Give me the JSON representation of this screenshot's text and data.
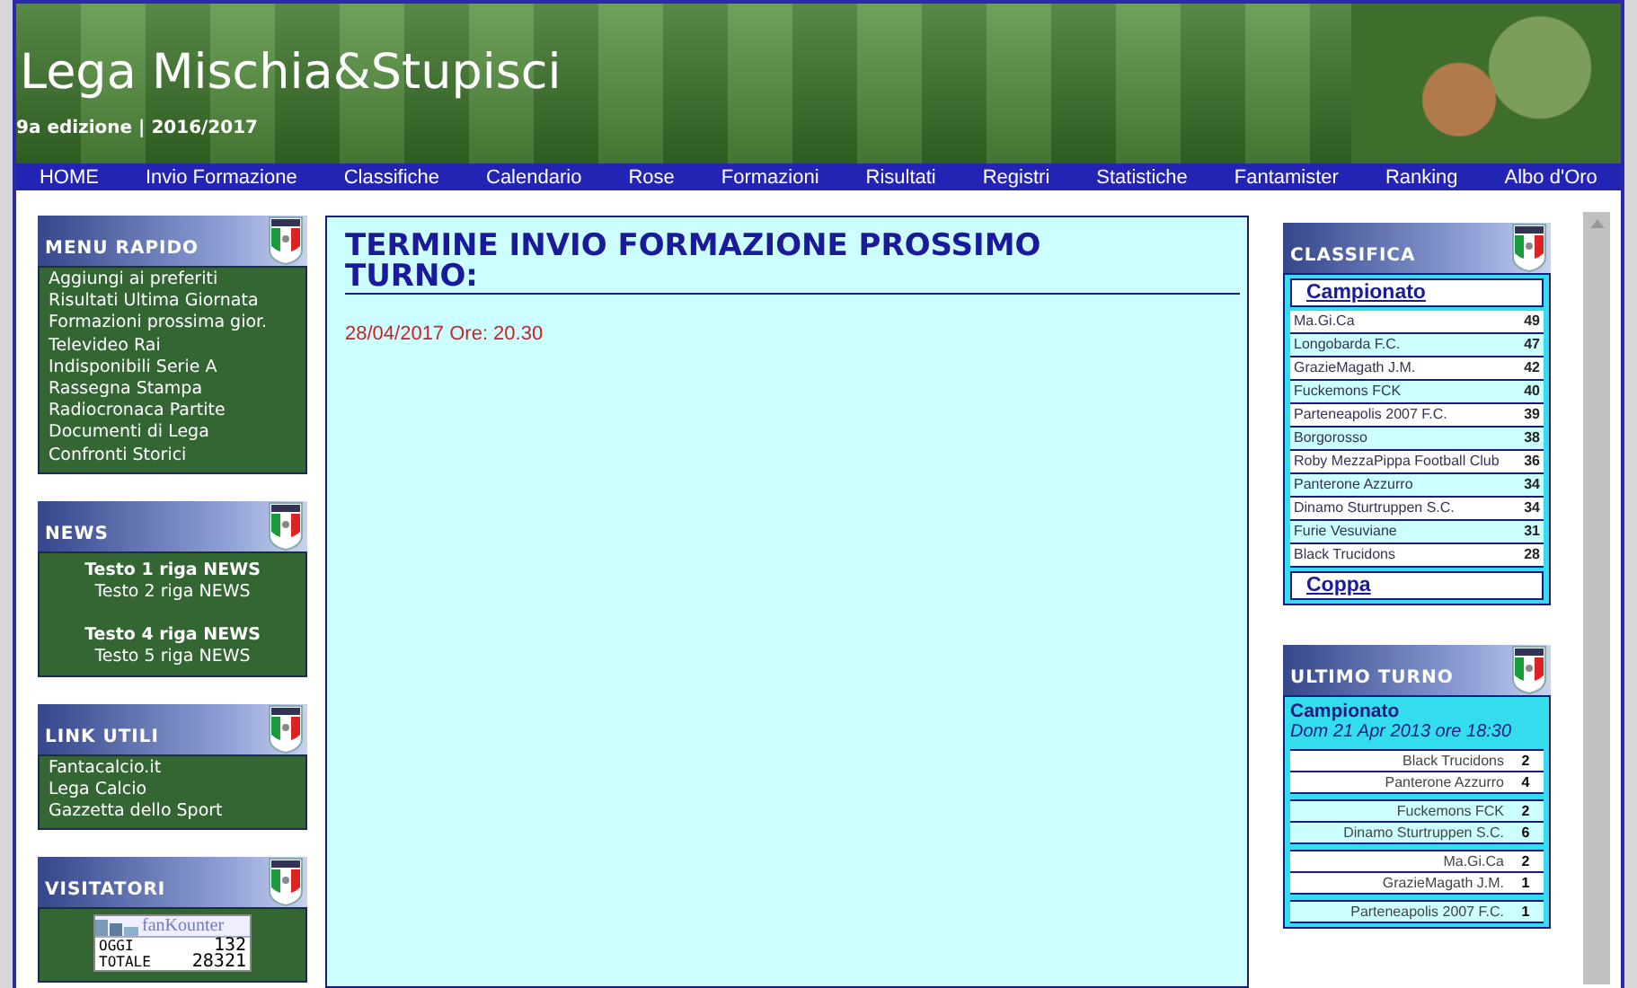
{
  "header": {
    "title": "Lega Mischia&Stupisci",
    "subtitle": "9a edizione | 2016/2017"
  },
  "nav": [
    "HOME",
    "Invio Formazione",
    "Classifiche",
    "Calendario",
    "Rose",
    "Formazioni",
    "Risultati",
    "Registri",
    "Statistiche",
    "Fantamister",
    "Ranking",
    "Albo d'Oro"
  ],
  "menu_rapido": {
    "title": "MENU RAPIDO",
    "items": [
      "Aggiungi ai preferiti",
      "Risultati Ultima Giornata",
      "Formazioni prossima gior.",
      "Televideo Rai",
      "Indisponibili Serie A",
      "Rassegna Stampa",
      "Radiocronaca Partite",
      "Documenti di Lega",
      "Confronti Storici"
    ]
  },
  "news": {
    "title": "NEWS",
    "groups": [
      {
        "lines": [
          {
            "text": "Testo 1 riga NEWS",
            "bold": true
          },
          {
            "text": "Testo 2 riga NEWS",
            "bold": false
          }
        ]
      },
      {
        "lines": [
          {
            "text": "Testo 4 riga NEWS",
            "bold": true
          },
          {
            "text": "Testo 5 riga NEWS",
            "bold": false
          }
        ]
      }
    ]
  },
  "link_utili": {
    "title": "LINK UTILI",
    "items": [
      "Fantacalcio.it",
      "Lega Calcio",
      "Gazzetta dello Sport"
    ]
  },
  "visitatori": {
    "title": "VISITATORI",
    "counter": {
      "brand": "fanKounter",
      "rows": [
        {
          "label": "OGGI",
          "value": "132"
        },
        {
          "label": "TOTALE",
          "value": "28321"
        }
      ]
    }
  },
  "main": {
    "heading": "TERMINE INVIO FORMAZIONE PROSSIMO TURNO:",
    "deadline": "28/04/2017 Ore: 20.30"
  },
  "classifica": {
    "title": "CLASSIFICA",
    "tab": "Campionato",
    "footer_tab": "Coppa",
    "rows": [
      {
        "team": "Ma.Gi.Ca",
        "points": "49"
      },
      {
        "team": "Longobarda F.C.",
        "points": "47"
      },
      {
        "team": "GrazieMagath J.M.",
        "points": "42"
      },
      {
        "team": "Fuckemons FCK",
        "points": "40"
      },
      {
        "team": "Parteneapolis 2007 F.C.",
        "points": "39"
      },
      {
        "team": "Borgorosso",
        "points": "38"
      },
      {
        "team": "Roby MezzaPippa Football Club",
        "points": "36"
      },
      {
        "team": "Panterone Azzurro",
        "points": "34"
      },
      {
        "team": "Dinamo Sturtruppen S.C.",
        "points": "34"
      },
      {
        "team": "Furie Vesuviane",
        "points": "31"
      },
      {
        "team": "Black Trucidons",
        "points": "28"
      }
    ]
  },
  "ultimo_turno": {
    "title": "ULTIMO TURNO",
    "competition": "Campionato",
    "date": "Dom 21 Apr 2013 ore 18:30",
    "matches": [
      {
        "teams": [
          {
            "team": "Black Trucidons",
            "score": "2"
          },
          {
            "team": "Panterone Azzurro",
            "score": "4"
          }
        ]
      },
      {
        "teams": [
          {
            "team": "Fuckemons FCK",
            "score": "2"
          },
          {
            "team": "Dinamo Sturtruppen S.C.",
            "score": "6"
          }
        ]
      },
      {
        "teams": [
          {
            "team": "Ma.Gi.Ca",
            "score": "2"
          },
          {
            "team": "GrazieMagath J.M.",
            "score": "1"
          }
        ]
      },
      {
        "teams": [
          {
            "team": "Parteneapolis 2007 F.C.",
            "score": "1"
          }
        ]
      }
    ]
  }
}
